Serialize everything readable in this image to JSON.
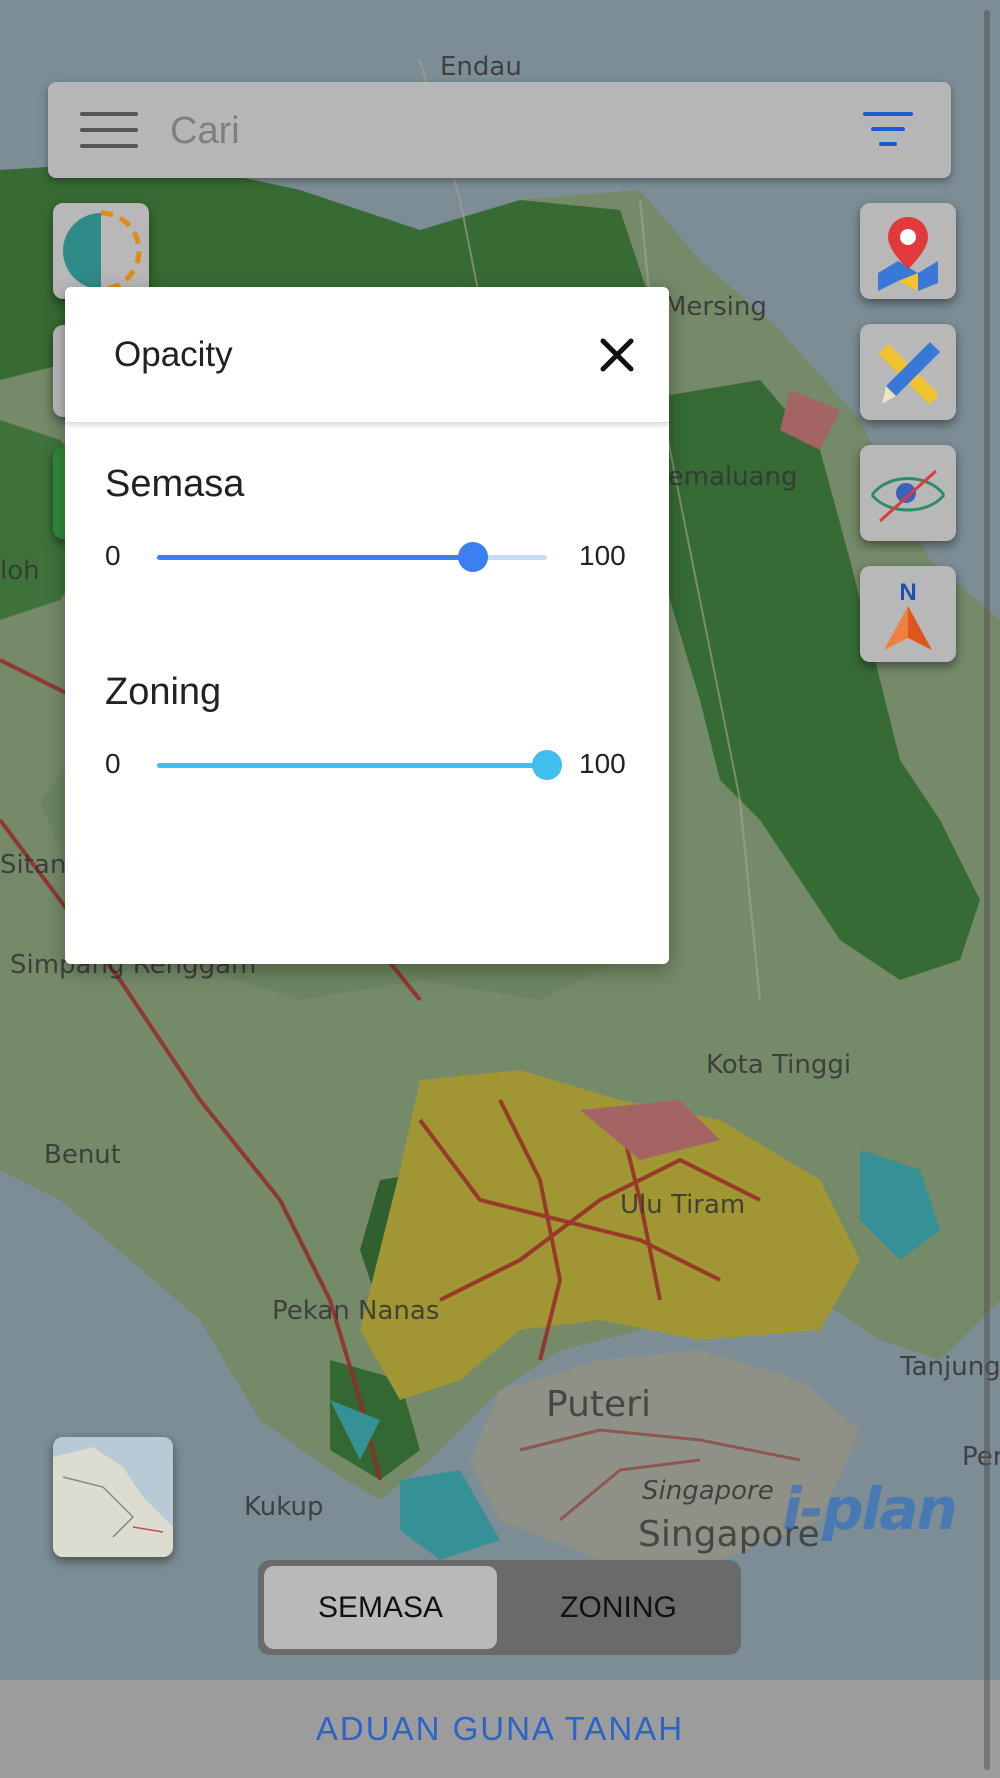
{
  "search": {
    "placeholder": "Cari"
  },
  "map": {
    "labels": {
      "endau": "Endau",
      "mersing": "Mersing",
      "jemaluang": "Jemaluang",
      "kota_tinggi": "Kota Tinggi",
      "benut": "Benut",
      "pekan_nanas": "Pekan Nanas",
      "ulu_tiram": "Ulu Tiram",
      "kukup": "Kukup",
      "puteri": "Puteri",
      "singapore_small": "Singapore",
      "singapore": "Singapore",
      "tanjung": "Tanjung",
      "pen": "Pen",
      "simpang_renggam": "Simpang Renggam",
      "sitan": "Sitan",
      "kluang": "loh"
    },
    "watermark": "i-plan"
  },
  "tools": {
    "icons": [
      "layer-opacity-icon",
      "map-pin-icon",
      "draw-measure-icon",
      "visibility-icon",
      "north-arrow-icon"
    ]
  },
  "modal": {
    "title": "Opacity",
    "sliders": [
      {
        "label": "Semasa",
        "min": "0",
        "max": "100",
        "value": 81,
        "color": "#3b7ff0",
        "track_color": "#c7dbfb"
      },
      {
        "label": "Zoning",
        "min": "0",
        "max": "100",
        "value": 100,
        "color": "#41bdf0",
        "track_color": "#c9ecfb"
      }
    ]
  },
  "layer_toggle": {
    "semasa": "SEMASA",
    "zoning": "ZONING"
  },
  "footer": {
    "link": "ADUAN GUNA TANAH"
  }
}
